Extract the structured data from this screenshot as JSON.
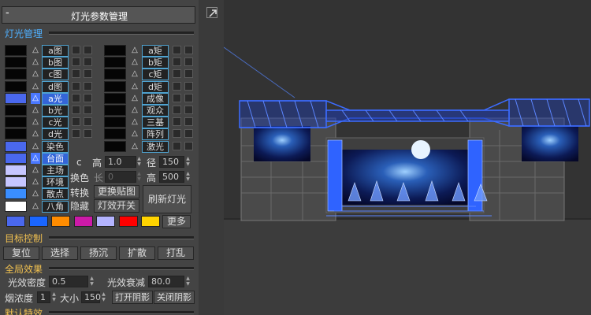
{
  "panel": {
    "title": "灯光参数管理",
    "minimize": "-",
    "sections": {
      "lights": "灯光管理",
      "target": "目标控制",
      "global": "全局效果",
      "defaults": "默认特效"
    },
    "left_rows": [
      {
        "color": "#050505",
        "label": "a图",
        "selected": false
      },
      {
        "color": "#050505",
        "label": "b图",
        "selected": false
      },
      {
        "color": "#050505",
        "label": "c图",
        "selected": false
      },
      {
        "color": "#050505",
        "label": "d图",
        "selected": false
      },
      {
        "color": "#4a68ee",
        "label": "a光",
        "selected": true
      },
      {
        "color": "#050505",
        "label": "b光",
        "selected": false
      },
      {
        "color": "#050505",
        "label": "c光",
        "selected": false
      },
      {
        "color": "#050505",
        "label": "d光",
        "selected": false
      },
      {
        "color": "#4a68ee",
        "label": "染色",
        "selected": false
      },
      {
        "color": "#4a68ee",
        "label": "台面",
        "selected": true
      },
      {
        "color": "#c6c6ff",
        "label": "主场",
        "selected": false
      },
      {
        "color": "#c6c6ff",
        "label": "环境",
        "selected": false
      },
      {
        "color": "#3a8eff",
        "label": "散点",
        "selected": false
      },
      {
        "color": "#ffffff",
        "label": "八角",
        "selected": false
      }
    ],
    "right_rows": [
      {
        "color": "#050505",
        "label": "a矩"
      },
      {
        "color": "#050505",
        "label": "b矩"
      },
      {
        "color": "#050505",
        "label": "c矩"
      },
      {
        "color": "#050505",
        "label": "d矩"
      },
      {
        "color": "#050505",
        "label": "成像"
      },
      {
        "color": "#050505",
        "label": "观众"
      },
      {
        "color": "#050505",
        "label": "三基"
      },
      {
        "color": "#050505",
        "label": "阵列"
      },
      {
        "color": "#050505",
        "label": "激光"
      }
    ],
    "controls": {
      "c_label": "c",
      "height_label": "高",
      "height_value": "1.0",
      "radius_label": "径",
      "radius_value": "150",
      "length_label": "长",
      "length_value": "0",
      "high_label": "高",
      "high_value": "500",
      "swap_color": "换色",
      "convert": "转换",
      "replace_map": "更换贴图",
      "refresh": "刷新灯光",
      "hide": "隐藏",
      "effect_switch": "灯效开关"
    },
    "palette": [
      "#4a68ee",
      "#1a66ff",
      "#ff8c00",
      "#cc1aa8",
      "#b4b4ff",
      "#ff0000",
      "#ffd400"
    ],
    "more": "更多",
    "target_buttons": [
      "复位",
      "选择",
      "扬沉",
      "扩散",
      "打乱"
    ],
    "global": {
      "density_label": "光效密度",
      "density_value": "0.5",
      "decay_label": "光效衰减",
      "decay_value": "80.0",
      "smoke_label": "烟浓度",
      "smoke_value": "1",
      "size_label": "大小",
      "size_value": "150",
      "shadow_on": "打开阴影",
      "shadow_off": "关闭阴影"
    }
  }
}
